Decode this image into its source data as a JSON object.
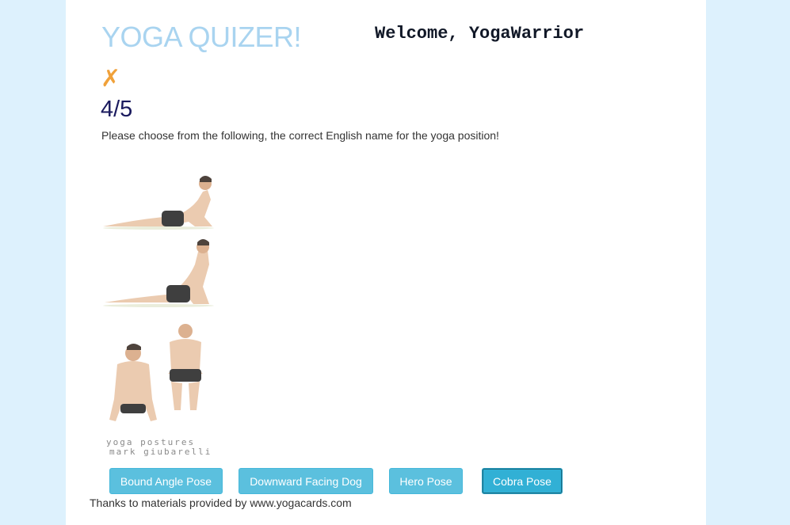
{
  "header": {
    "title": "YOGA QUIZER!",
    "welcome": "Welcome, YogaWarrior"
  },
  "quiz": {
    "result_mark": "✗",
    "progress": "4/5",
    "instructions": "Please choose from the following, the correct English name for the yoga position!",
    "image": {
      "watermark_line1": "yoga postures",
      "watermark_line2": "mark giubarelli"
    },
    "answers": [
      {
        "label": "Bound Angle Pose"
      },
      {
        "label": "Downward Facing Dog"
      },
      {
        "label": "Hero Pose"
      },
      {
        "label": "Cobra Pose",
        "focused": true
      }
    ]
  },
  "footer": {
    "credits": "Thanks to materials provided by www.yogacards.com"
  },
  "colors": {
    "background": "#ddf1fd",
    "title": "#a9d4f0",
    "mark": "#f0a13a",
    "score": "#1a1a5e",
    "button": "#5bc0de"
  }
}
